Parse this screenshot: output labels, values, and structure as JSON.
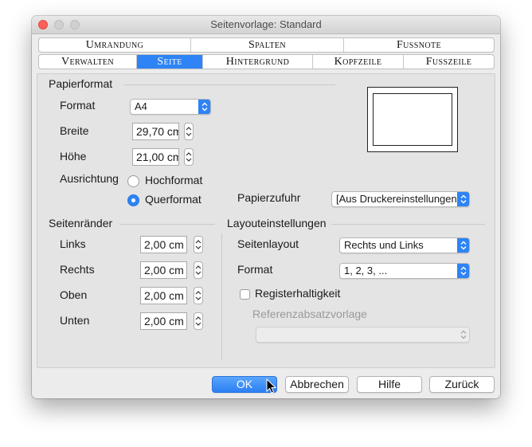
{
  "window": {
    "title": "Seitenvorlage: Standard"
  },
  "tabs_row1": [
    "Umrandung",
    "Spalten",
    "Fussnote"
  ],
  "tabs_row2": [
    "Verwalten",
    "Seite",
    "Hintergrund",
    "Kopfzeile",
    "Fusszeile"
  ],
  "active_tab": "Seite",
  "papierformat": {
    "title": "Papierformat",
    "format_label": "Format",
    "format_value": "A4",
    "breite_label": "Breite",
    "breite_value": "29,70 cm",
    "hoehe_label": "Höhe",
    "hoehe_value": "21,00 cm",
    "ausrichtung_label": "Ausrichtung",
    "hochformat_label": "Hochformat",
    "querformat_label": "Querformat",
    "selected_orientation": "Querformat",
    "papierzufuhr_label": "Papierzufuhr",
    "papierzufuhr_value": "[Aus Druckereinstellungen]"
  },
  "seitenraender": {
    "title": "Seitenränder",
    "links_label": "Links",
    "links_value": "2,00 cm",
    "rechts_label": "Rechts",
    "rechts_value": "2,00 cm",
    "oben_label": "Oben",
    "oben_value": "2,00 cm",
    "unten_label": "Unten",
    "unten_value": "2,00 cm"
  },
  "layout": {
    "title": "Layouteinstellungen",
    "seitenlayout_label": "Seitenlayout",
    "seitenlayout_value": "Rechts und Links",
    "format_label": "Format",
    "format_value": "1, 2, 3, ...",
    "registerhaltigkeit_label": "Registerhaltigkeit",
    "registerhaltigkeit_checked": false,
    "referenz_label": "Referenzabsatzvorlage",
    "referenz_value": ""
  },
  "buttons": {
    "ok": "OK",
    "cancel": "Abbrechen",
    "help": "Hilfe",
    "back": "Zurück"
  },
  "colors": {
    "accent": "#2e83f5",
    "close_light": "#fc605b"
  }
}
